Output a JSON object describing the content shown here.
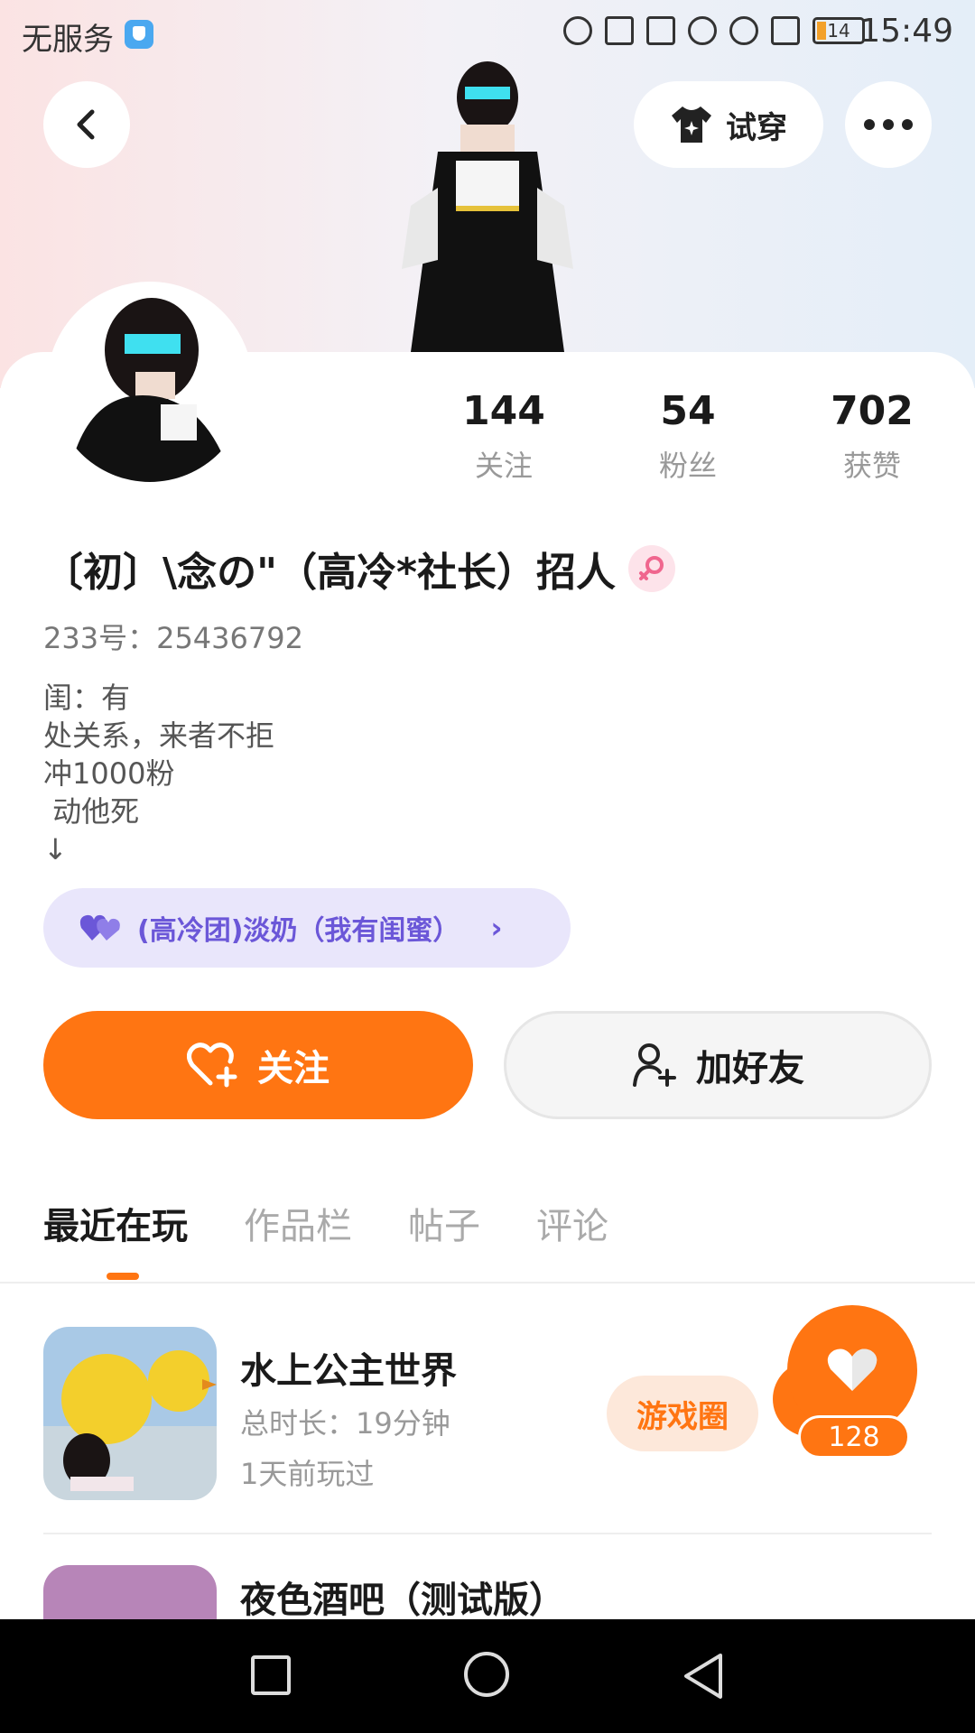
{
  "status_bar": {
    "carrier": "无服务",
    "battery": "14",
    "time": "15:49"
  },
  "header": {
    "tryon_label": "试穿"
  },
  "profile": {
    "stats": [
      {
        "value": "144",
        "label": "关注"
      },
      {
        "value": "54",
        "label": "粉丝"
      },
      {
        "value": "702",
        "label": "获赞"
      }
    ],
    "name": "〔初〕\\念の\"（高冷*社长）招人",
    "uid": "233号：25436792",
    "bio": "闺：有\n处关系，来者不拒\n冲1000粉\n 动他死\n↓",
    "relation": "(高冷团)淡奶（我有闺蜜）"
  },
  "actions": {
    "follow_label": "关注",
    "add_friend_label": "加好友"
  },
  "tabs": [
    {
      "label": "最近在玩",
      "active": true
    },
    {
      "label": "作品栏",
      "active": false
    },
    {
      "label": "帖子",
      "active": false
    },
    {
      "label": "评论",
      "active": false
    }
  ],
  "games": [
    {
      "title": "水上公主世界",
      "duration": "总时长：19分钟",
      "last_played": "1天前玩过",
      "circle_label": "游戏圈",
      "likes": "128"
    },
    {
      "title": "夜色酒吧（测试版）"
    }
  ],
  "colors": {
    "accent": "#ff7512",
    "relation_bg": "#e9e6fb",
    "relation_text": "#6b57d8"
  }
}
